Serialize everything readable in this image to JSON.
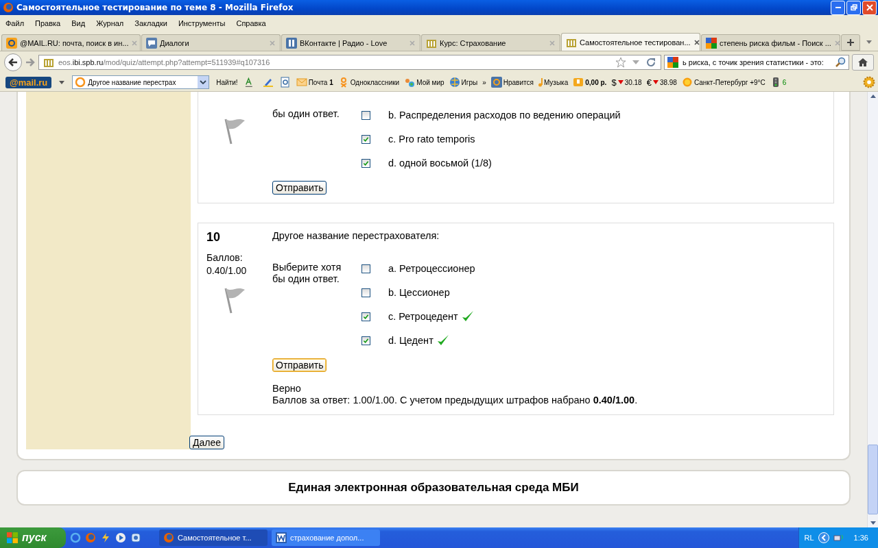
{
  "window": {
    "title": "Самостоятельное тестирование по теме 8 - Mozilla Firefox"
  },
  "menu": [
    "Файл",
    "Правка",
    "Вид",
    "Журнал",
    "Закладки",
    "Инструменты",
    "Справка"
  ],
  "tabs": [
    {
      "title": "@MAIL.RU: почта, поиск в ин...",
      "selected": false
    },
    {
      "title": "Диалоги",
      "selected": false
    },
    {
      "title": "ВКонтакте | Радио - Love",
      "selected": false
    },
    {
      "title": "Курс: Страхование",
      "selected": false
    },
    {
      "title": "Самостоятельное тестирован...",
      "selected": true
    },
    {
      "title": "степень риска фильм - Поиск ...",
      "selected": false
    }
  ],
  "address": {
    "prefix": "eos.",
    "host": "ibi.spb.ru",
    "path": "/mod/quiz/attempt.php?attempt=511939#q107316"
  },
  "search": {
    "value": "ь риска, с точик зрения статистики - это:"
  },
  "mail_toolbar": {
    "logo": "@mail.ru",
    "query": "Другое название перестрах",
    "find": "Найти!",
    "items": [
      {
        "kind": "mail",
        "label": "Почта **1**"
      },
      {
        "kind": "ok",
        "label": "Одноклассники"
      },
      {
        "kind": "world",
        "label": "Мой мир"
      },
      {
        "kind": "globe",
        "label": "Игры"
      },
      {
        "kind": "more",
        "label": "»"
      },
      {
        "kind": "at",
        "label": "Нравится"
      },
      {
        "kind": "music",
        "label": "Музыка"
      },
      {
        "kind": "wallet",
        "label": "**0,00 р.**"
      },
      {
        "kind": "currency",
        "symbol": "$",
        "label": "30.18"
      },
      {
        "kind": "currency",
        "symbol": "€",
        "label": "38.98"
      },
      {
        "kind": "sun",
        "label": "Санкт-Петербург +9°C"
      },
      {
        "kind": "traffic",
        "label": "6"
      }
    ]
  },
  "questions": [
    {
      "instruction": "бы один ответ.",
      "options": [
        {
          "label": "b. Распределения расходов по ведению операций",
          "checked": false,
          "correct": false
        },
        {
          "label": "c. Pro rato temporis",
          "checked": true,
          "correct": false
        },
        {
          "label": "d. одной восьмой (1/8)",
          "checked": true,
          "correct": false
        }
      ],
      "submit": "Отправить",
      "submit_highlighted": false
    },
    {
      "number": "10",
      "grade_label": "Баллов:",
      "grade": "0.40/1.00",
      "text": "Другое название перестрахователя:",
      "instruction": "Выберите хотя бы один ответ.",
      "options": [
        {
          "label": "a. Ретроцессионер",
          "checked": false,
          "correct": false
        },
        {
          "label": "b. Цессионер",
          "checked": false,
          "correct": false
        },
        {
          "label": "c. Ретроцедент",
          "checked": true,
          "correct": true
        },
        {
          "label": "d. Цедент",
          "checked": true,
          "correct": true
        }
      ],
      "submit": "Отправить",
      "submit_highlighted": true,
      "feedback_title": "Верно",
      "feedback": "Баллов за ответ: 1.00/1.00. С учетом предыдущих штрафов набрано **0.40/1.00**."
    }
  ],
  "next_button": "Далее",
  "footer": "Единая электронная образовательная среда МБИ",
  "taskbar": {
    "start": "пуск",
    "tasks": [
      {
        "title": "Самостоятельное т...",
        "selected": true
      },
      {
        "title": "страхование допол...",
        "selected": false
      }
    ],
    "lang": "RL",
    "clock": "1:36"
  }
}
